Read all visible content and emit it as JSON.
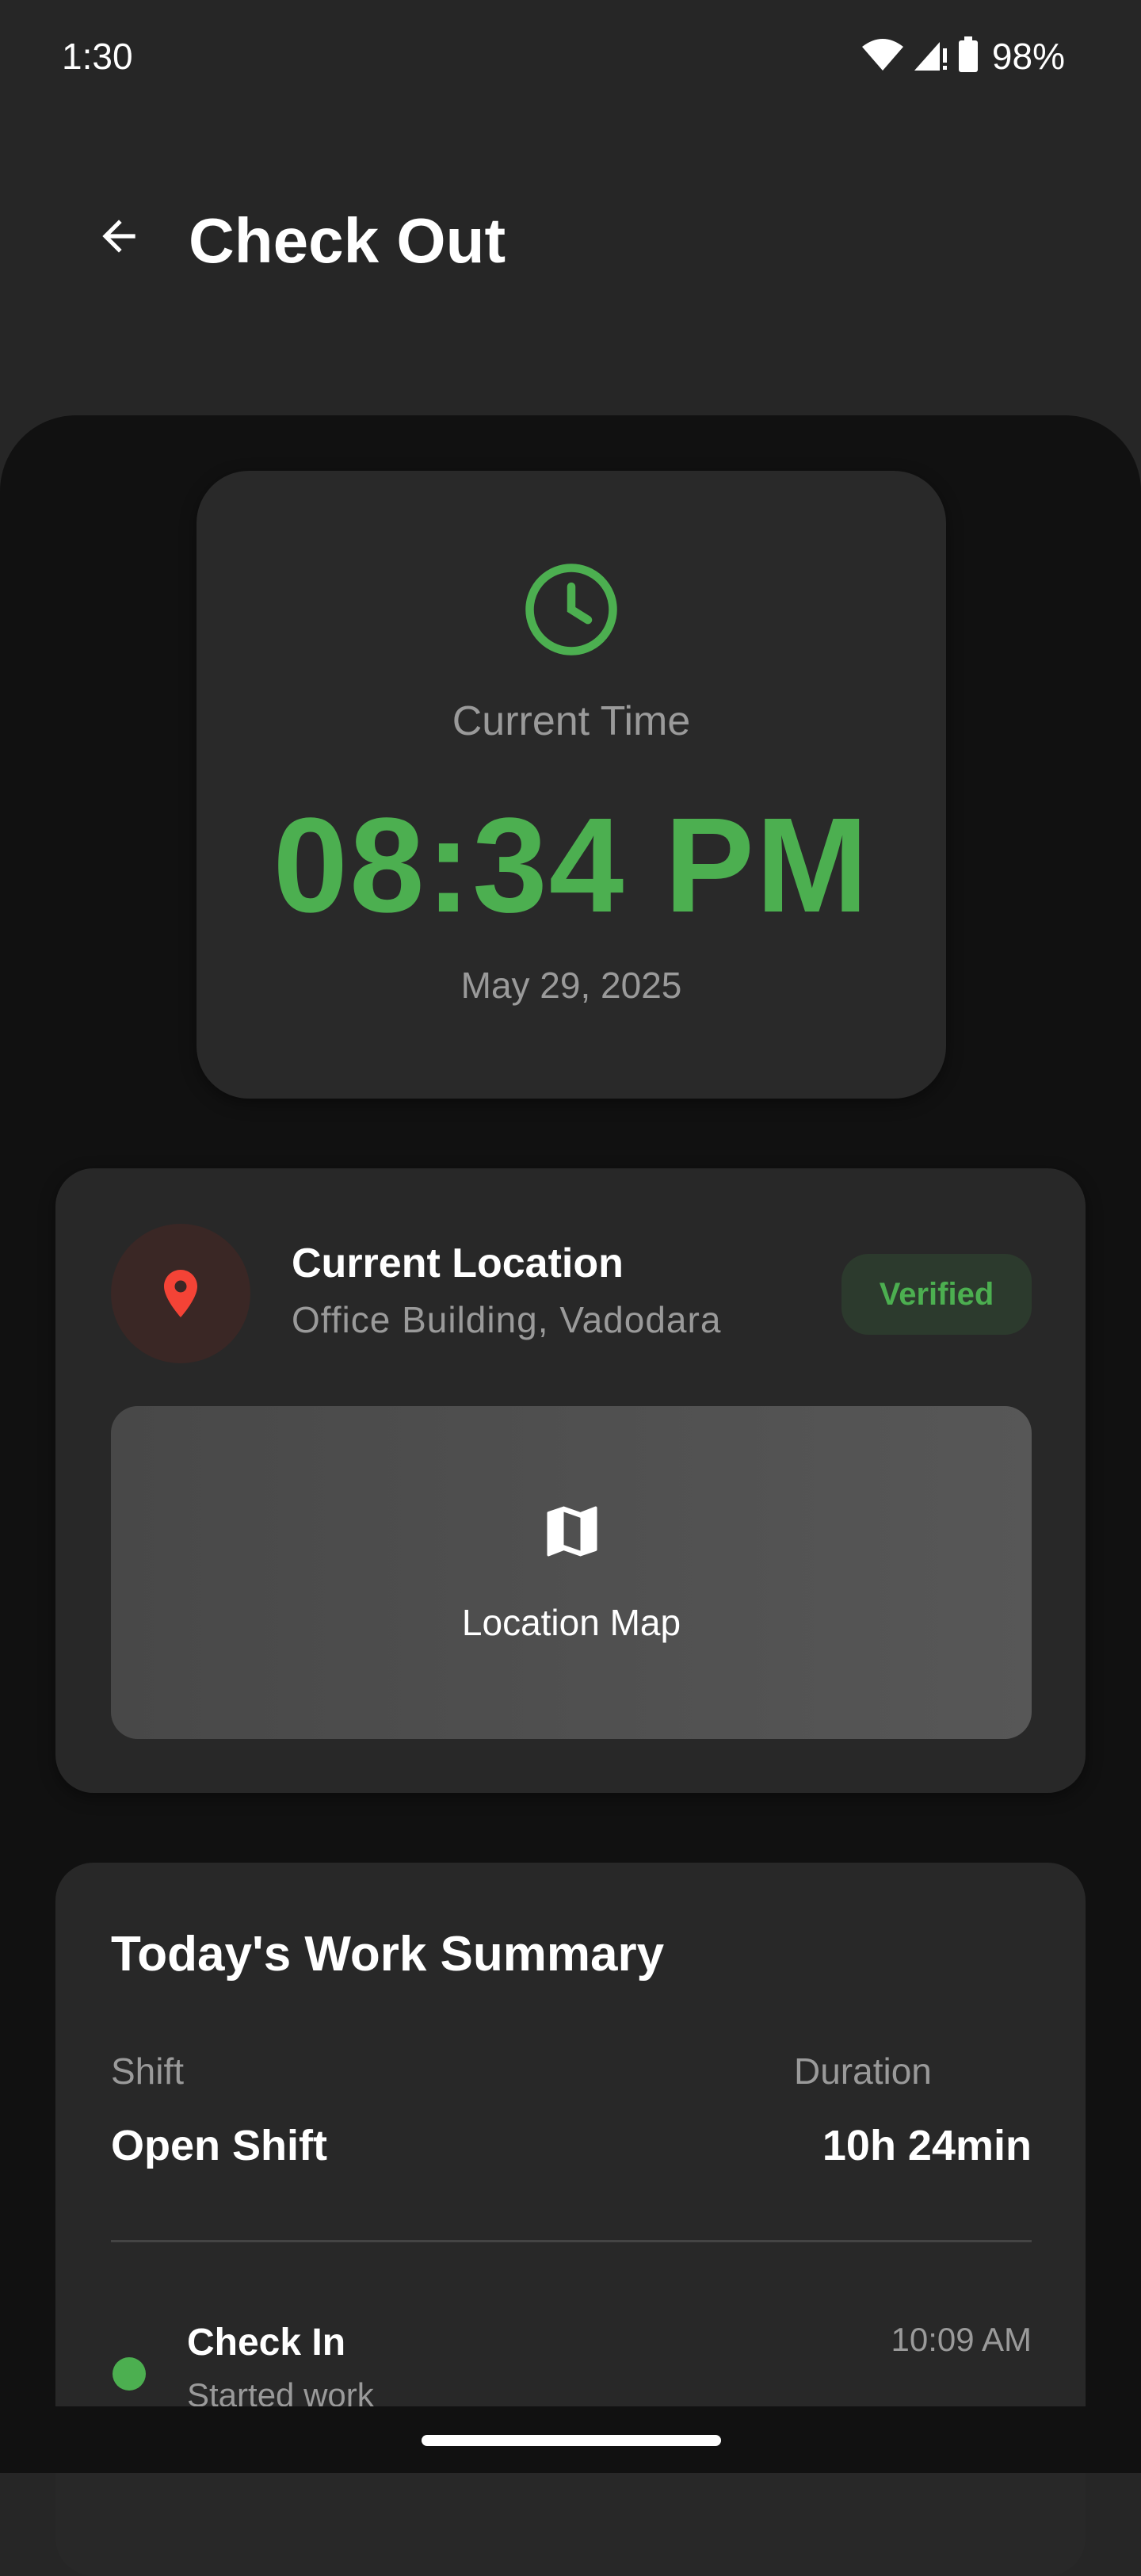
{
  "status_bar": {
    "time": "1:30",
    "battery": "98%",
    "icons": [
      "wifi-icon",
      "signal-icon",
      "battery-icon"
    ]
  },
  "appbar": {
    "title": "Check Out",
    "back_icon": "arrow-left-icon"
  },
  "time_card": {
    "icon": "clock-icon",
    "label": "Current Time",
    "time": "08:34 PM",
    "date": "May 29, 2025"
  },
  "location_card": {
    "icon": "location-pin-icon",
    "title": "Current Location",
    "subtitle": "Office Building, Vadodara",
    "badge": "Verified",
    "map_icon": "map-icon",
    "map_label": "Location Map"
  },
  "summary_card": {
    "title": "Today's Work Summary",
    "shift_label": "Shift",
    "shift_value": "Open Shift",
    "duration_label": "Duration",
    "duration_value": "10h 24min",
    "timeline": [
      {
        "title": "Check In",
        "subtitle": "Started work",
        "time": "10:09 AM"
      }
    ]
  },
  "colors": {
    "accent_green": "#4caf50",
    "pin_red": "#f44336",
    "background": "#111111",
    "card": "#282828"
  }
}
